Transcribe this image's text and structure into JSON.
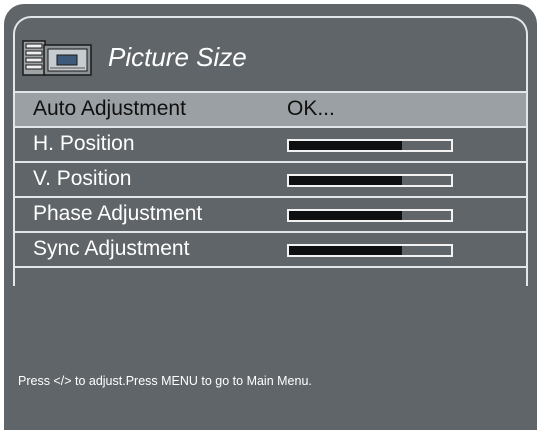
{
  "menu": {
    "title": "Picture Size",
    "title_icon": "monitor-settings-icon",
    "items": [
      {
        "label": "Auto Adjustment",
        "value": "OK...",
        "selected": true
      },
      {
        "label": "H. Position",
        "level": 0.7
      },
      {
        "label": "V. Position",
        "level": 0.7
      },
      {
        "label": "Phase Adjustment",
        "level": 0.7
      },
      {
        "label": "Sync Adjustment",
        "level": 0.7
      }
    ]
  },
  "hint": "Press </> to adjust.Press MENU to go to Main Menu.",
  "colors": {
    "panel": "#5f6568",
    "selected_row": "#9aa0a3",
    "border": "#e3e6e8",
    "bar_fill": "#0d0f10"
  }
}
